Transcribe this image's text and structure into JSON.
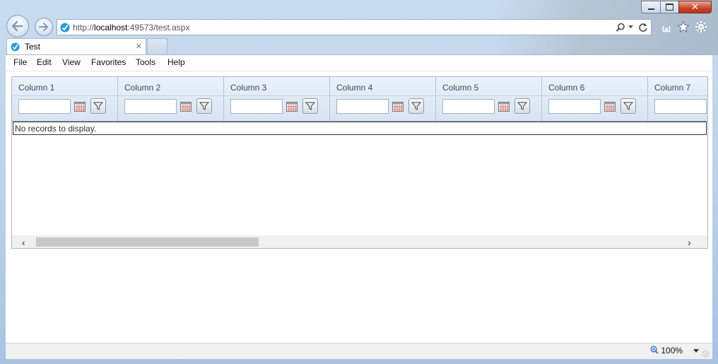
{
  "browser": {
    "address": {
      "prefix": "http://",
      "host": "localhost",
      "rest": ":49573/test.aspx"
    },
    "tab_title": "Test",
    "tab_close": "×",
    "close_glyph": "✕"
  },
  "menu": [
    "File",
    "Edit",
    "View",
    "Favorites",
    "Tools",
    "Help"
  ],
  "grid": {
    "columns": [
      "Column 1",
      "Column 2",
      "Column 3",
      "Column 4",
      "Column 5",
      "Column 6",
      "Column 7"
    ],
    "empty_message": "No records to display.",
    "scroll_left": "‹",
    "scroll_right": "›",
    "scroll_position": 0
  },
  "status": {
    "zoom": "100%"
  },
  "colors": {
    "accent": "#2a9bd6",
    "header": "#dce7f3",
    "close": "#c7432b"
  }
}
